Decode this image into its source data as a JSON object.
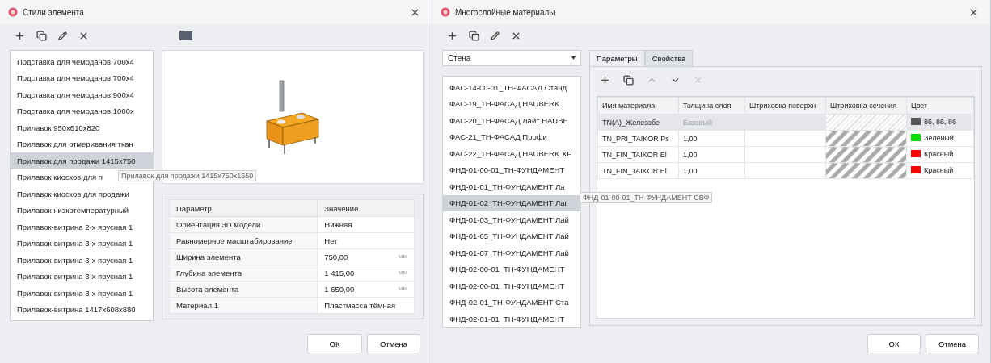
{
  "left_dialog": {
    "title": "Стили элемента",
    "styles": [
      {
        "label": "Подставка для чемоданов 700х4",
        "selected": false
      },
      {
        "label": "Подставка для чемоданов 700х4",
        "selected": false
      },
      {
        "label": "Подставка для чемоданов 900х4",
        "selected": false
      },
      {
        "label": "Подставка для чемоданов 1000х",
        "selected": false
      },
      {
        "label": "Прилавок 950х610х820",
        "selected": false
      },
      {
        "label": "Прилавок для отмеривания ткан",
        "selected": false
      },
      {
        "label": "Прилавок для продажи 1415х750",
        "selected": true
      },
      {
        "label": "Прилавок киосков для п",
        "selected": false
      },
      {
        "label": "Прилавок киосков для продажи",
        "selected": false
      },
      {
        "label": "Прилавок низкотемпературный",
        "selected": false
      },
      {
        "label": "Прилавок-витрина 2-х ярусная 1",
        "selected": false
      },
      {
        "label": "Прилавок-витрина 3-х ярусная 1",
        "selected": false
      },
      {
        "label": "Прилавок-витрина 3-х ярусная 1",
        "selected": false
      },
      {
        "label": "Прилавок-витрина 3-х ярусная 1",
        "selected": false
      },
      {
        "label": "Прилавок-витрина 3-х ярусная 1",
        "selected": false
      },
      {
        "label": "Прилавок-витрина 1417х608х880",
        "selected": false
      }
    ],
    "tooltip": "Прилавок для продажи 1415х750х1650",
    "properties": {
      "columns": [
        "Параметр",
        "Значение"
      ],
      "rows": [
        {
          "name": "Ориентация 3D модели",
          "value": "Нижняя"
        },
        {
          "name": "Равномерное масштабирование",
          "value": "Нет"
        },
        {
          "name": "Ширина элемента",
          "value": "750,00",
          "unit": "мм"
        },
        {
          "name": "Глубина элемента",
          "value": "1 415,00",
          "unit": "мм"
        },
        {
          "name": "Высота элемента",
          "value": "1 650,00",
          "unit": "мм"
        },
        {
          "name": "Материал 1",
          "value": "Пластмасса тёмная"
        }
      ]
    },
    "buttons": [
      "ОК",
      "Отмена"
    ]
  },
  "right_dialog": {
    "title": "Многослойные материалы",
    "category": "Стена",
    "materials": [
      {
        "label": "ФАС-14-00-01_ТН-ФАСАД Станд",
        "selected": false
      },
      {
        "label": "ФАС-19_ТН-ФАСАД HAUBERK",
        "selected": false
      },
      {
        "label": "ФАС-20_ТН-ФАСАД Лайт HAUBE",
        "selected": false
      },
      {
        "label": "ФАС-21_ТН-ФАСАД Профи",
        "selected": false
      },
      {
        "label": "ФАС-22_ТН-ФАСАД HAUBERK ХР",
        "selected": false
      },
      {
        "label": "ФНД-01-00-01_ТН-ФУНДАМЕНТ",
        "selected": false
      },
      {
        "label": "ФНД-01-01_ТН-ФУНДАМЕНТ Ла",
        "selected": false
      },
      {
        "label": "ФНД-01-02_ТН-ФУНДАМЕНТ Лаг",
        "selected": true
      },
      {
        "label": "ФНД-01-03_ТН-ФУНДАМЕНТ Лай",
        "selected": false
      },
      {
        "label": "ФНД-01-05_ТН-ФУНДАМЕНТ Лай",
        "selected": false
      },
      {
        "label": "ФНД-01-07_ТН-ФУНДАМЕНТ Лай",
        "selected": false
      },
      {
        "label": "ФНД-02-00-01_ТН-ФУНДАМЕНТ",
        "selected": false
      },
      {
        "label": "ФНД-02-00-01_ТН-ФУНДАМЕНТ",
        "selected": false
      },
      {
        "label": "ФНД-02-01_ТН-ФУНДАМЕНТ Ста",
        "selected": false
      },
      {
        "label": "ФНД-02-01-01_ТН-ФУНДАМЕНТ",
        "selected": false
      }
    ],
    "tooltip": "ФНД-01-00-01_ТН-ФУНДАМЕНТ СВФ",
    "tabs": [
      {
        "label": "Параметры",
        "selected": true
      },
      {
        "label": "Свойства",
        "selected": false
      }
    ],
    "layers_toolbar": {
      "delete_disabled": true
    },
    "layers": {
      "columns": [
        "Имя материала",
        "Толщина слоя",
        "Штриховка поверхн",
        "Штриховка сечения",
        "Цвет"
      ],
      "rows": [
        {
          "name": "TN(A)_Железобе",
          "thickness": "Базовый",
          "thickness_muted": true,
          "color": "#565656",
          "color_label": "86, 86, 86",
          "selected": true
        },
        {
          "name": "TN_PRI_TAIKOR Ps",
          "thickness": "1,00",
          "thickness_muted": false,
          "color": "#00e000",
          "color_label": "Зелёный",
          "selected": false
        },
        {
          "name": "TN_FIN_TAIKOR El",
          "thickness": "1,00",
          "thickness_muted": false,
          "color": "#ff0000",
          "color_label": "Красный",
          "selected": false
        },
        {
          "name": "TN_FIN_TAIKOR El",
          "thickness": "1,00",
          "thickness_muted": false,
          "color": "#ff0000",
          "color_label": "Красный",
          "selected": false
        }
      ]
    },
    "buttons": [
      "ОК",
      "Отмена"
    ]
  }
}
